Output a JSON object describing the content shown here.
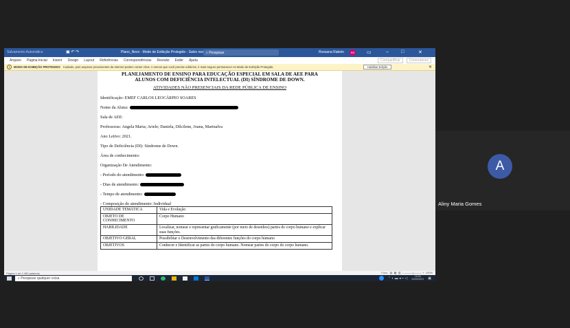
{
  "word": {
    "title_bar": {
      "autosave": "Salvamento Automático",
      "doc_title": "Plano_Novo - Modo de Exibição Protegido - Salvo neste PC",
      "search_placeholder": "Pesquisar",
      "user_name": "Rossana Rabelo",
      "user_initials": "RR"
    },
    "menu": {
      "items": [
        "Arquivo",
        "Página Inicial",
        "Inserir",
        "Design",
        "Layout",
        "Referências",
        "Correspondências",
        "Revisão",
        "Exibir",
        "Ajuda"
      ],
      "share": "Compartilhar",
      "comments": "Comentários"
    },
    "protected_bar": {
      "label": "MODO DE EXIBIÇÃO PROTEGIDO",
      "message": "Cuidado, pois arquivos provenientes da Internet podem conter vírus. A menos que você precise editá-los, é mais seguro permanecer no Modo de Exibição Protegido.",
      "button": "Habilitar Edição"
    },
    "document": {
      "heading_line1": "PLANEJAMENTO DE ENSINO PARA EDUCAÇÃO ESPECIAL EM SALA DE AEE PARA",
      "heading_line2": "ALUNOS COM DEFICIÊNCIA INTELECTUAL (DI) SÍNDROME DE DOWN.",
      "subheading": "ATIVIDADES NÃO PRESENCIAIS DA REDE PÚBLICA DE ENSINO",
      "lines": {
        "identificacao": "Identificação: EMEF CARLOS LEOCÁRPIO SOARES",
        "nome_aluno": "Nome da Aluna:",
        "sala": "Sala de AEE:",
        "professoras": "Professoras:  Angela Maria; Ariele; Daniela, Dilcilene, Joana, Marinalva",
        "ano": "Ano Letivo: 2021.",
        "tipo": "Tipo de Deficiência (DI): Síndrome de Down.",
        "area": "Área de conhecimento:",
        "organizacao": "Organização De Atendimento:",
        "periodo": "- Período do atendimento:",
        "dias": "- Dias de atendimento:",
        "tempo": "- Tempo de atendimento:",
        "composicao": "- Composição do atendimento: Individual"
      },
      "table": [
        {
          "key": "UNIDADE TEMÁTICA",
          "value": "Vida e Evolução"
        },
        {
          "key": "OBJETO DE CONHECIMENTO",
          "value": "Corpo Humano"
        },
        {
          "key": "HABILIDADE",
          "value": "Localizar, nomear e representar graficamente (por meio de desenhos) partes do corpo humano e explicar suas funções."
        },
        {
          "key": "OBJETIVO GERAL",
          "value": "Possibilitar o Desenvolvimento das diferentes funções do corpo humano"
        },
        {
          "key": "OBJETIVOS",
          "value": "Conhecer e Identificar as partes do corpo humano. Nomear partes do corpo do corpo humano."
        }
      ]
    },
    "status": {
      "left": "Página 1 de 2   450 palavras",
      "right": "Foco",
      "zoom": "100%"
    }
  },
  "taskbar": {
    "search_placeholder": "Pesquisar qualquer coisa",
    "time": "16:54",
    "date": "20/05/2021"
  },
  "participant": {
    "initial": "A",
    "name": "Aliny Maria Gomes"
  },
  "colors": {
    "word_blue": "#2b579a",
    "avatar_blue": "#3d5aa6",
    "protected_yellow": "#fcf3c7"
  }
}
